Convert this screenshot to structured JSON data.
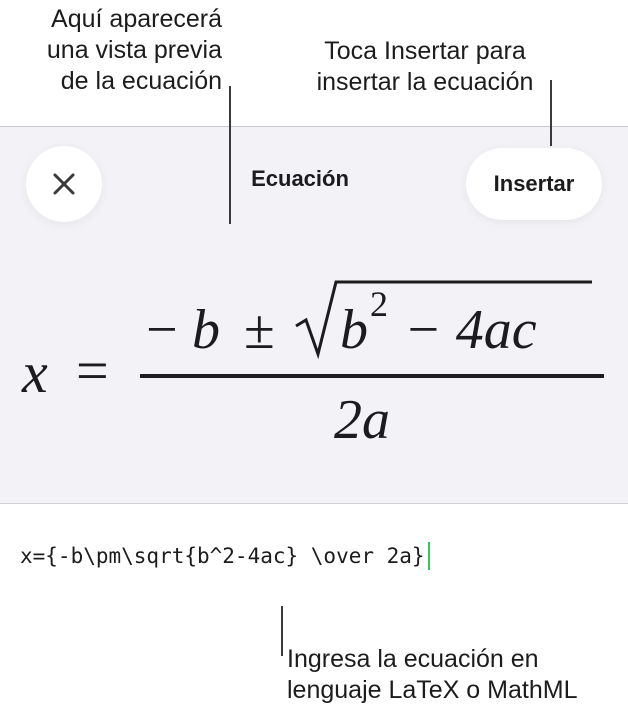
{
  "callouts": {
    "preview": [
      "Aquí aparecerá",
      "una vista previa",
      "de la ecuación"
    ],
    "insert": [
      "Toca Insertar para",
      "insertar la ecuación"
    ],
    "input": [
      "Ingresa la ecuación en",
      "lenguaje LaTeX o MathML"
    ]
  },
  "header": {
    "title": "Ecuación",
    "insert_label": "Insertar",
    "close_icon": "close-icon"
  },
  "preview": {
    "lhs": "x",
    "equals": "=",
    "numerator_minus": "−",
    "numerator_b": "b",
    "numerator_pm": "±",
    "radicand_b": "b",
    "radicand_exp": "2",
    "radicand_rest": "− 4ac",
    "denominator": "2a"
  },
  "input": {
    "value": "x={-b\\pm\\sqrt{b^2-4ac} \\over 2a}"
  },
  "colors": {
    "sheet_background": "#f2f2f7",
    "button_background": "#ffffff",
    "caret": "#34c759",
    "text": "#1c1c1e"
  }
}
